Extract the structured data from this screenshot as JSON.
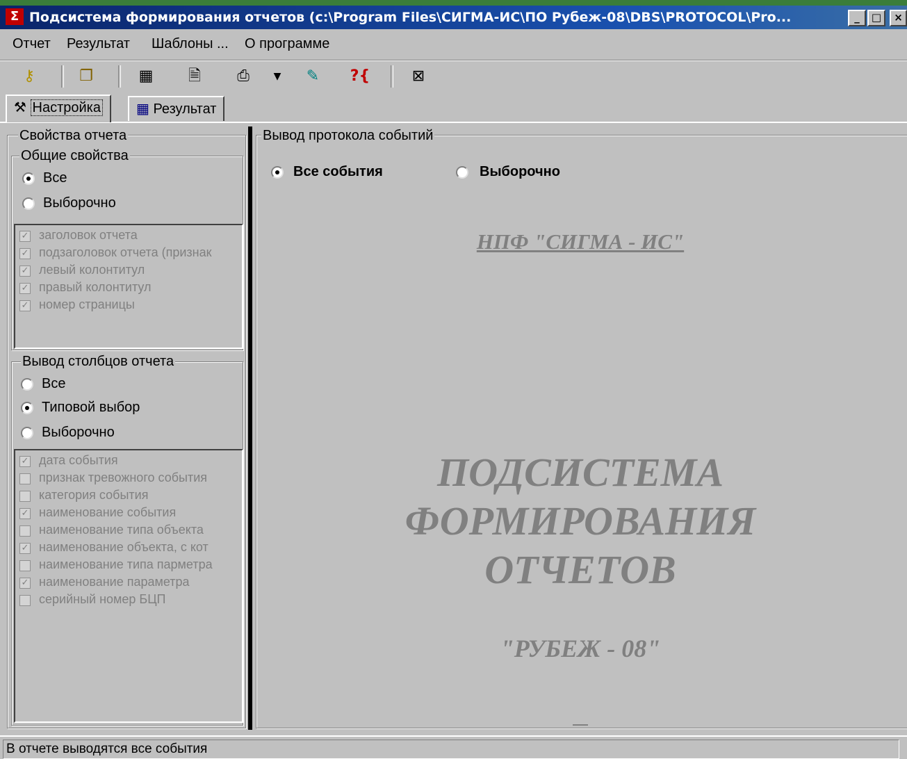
{
  "window": {
    "title": "Подсистема формирования отчетов (c:\\Program Files\\СИГМА-ИС\\ПО Рубеж-08\\DBS\\PROTOCOL\\Pro...",
    "app_icon": "sigma-icon",
    "buttons": {
      "minimize": "_",
      "maximize": "□",
      "close": "×"
    }
  },
  "menu": [
    "Отчет",
    "Результат",
    "Шаблоны ...",
    "О программе"
  ],
  "toolbar": [
    "key-icon",
    "folders-icon",
    "table-icon",
    "document-icon",
    "printer-icon",
    "dropdown-arrow-icon",
    "wizard-icon",
    "help-icon",
    "exit-icon"
  ],
  "tabs": [
    {
      "label": "Настройка",
      "active": true
    },
    {
      "label": "Результат",
      "active": false
    }
  ],
  "report_props": {
    "title": "Свойства отчета",
    "general": {
      "title": "Общие свойства",
      "options": [
        {
          "label": "Все",
          "selected": true
        },
        {
          "label": "Выборочно",
          "selected": false
        }
      ],
      "items": [
        {
          "label": "заголовок отчета",
          "checked": true
        },
        {
          "label": "подзаголовок отчета (признак",
          "checked": true
        },
        {
          "label": "левый колонтитул",
          "checked": true
        },
        {
          "label": "правый колонтитул",
          "checked": true
        },
        {
          "label": "номер страницы",
          "checked": true
        }
      ]
    },
    "columns": {
      "title": "Вывод столбцов отчета",
      "options": [
        {
          "label": "Все",
          "selected": false
        },
        {
          "label": "Типовой выбор",
          "selected": true
        },
        {
          "label": "Выборочно",
          "selected": false
        }
      ],
      "items": [
        {
          "label": "дата события",
          "checked": true
        },
        {
          "label": "признак тревожного события",
          "checked": false
        },
        {
          "label": "категория события",
          "checked": false
        },
        {
          "label": "наименование события",
          "checked": true
        },
        {
          "label": "наименование типа объекта",
          "checked": false
        },
        {
          "label": "наименование объекта, с кот",
          "checked": true
        },
        {
          "label": "наименование типа парметра",
          "checked": false
        },
        {
          "label": "наименование параметра",
          "checked": true
        },
        {
          "label": "серийный номер БЦП",
          "checked": false
        }
      ]
    }
  },
  "events": {
    "title": "Вывод протокола событий",
    "options": [
      {
        "label": "Все события",
        "selected": true
      },
      {
        "label": "Выборочно",
        "selected": false
      }
    ],
    "company": "НПФ \"СИГМА - ИС\"",
    "big_line1": "ПОДСИСТЕМА",
    "big_line2": "ФОРМИРОВАНИЯ",
    "big_line3": "ОТЧЕТОВ",
    "product": "\"РУБЕЖ - 08\""
  },
  "status": "В отчете выводятся все события"
}
